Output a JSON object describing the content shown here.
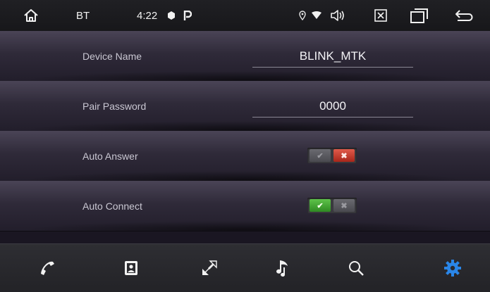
{
  "status_bar": {
    "app_label": "BT",
    "time": "4:22",
    "icons": [
      "home-icon",
      "record-icon",
      "parking-icon",
      "location-pin-icon",
      "wifi-icon",
      "volume-icon",
      "close-box-icon",
      "recent-apps-icon",
      "back-icon"
    ]
  },
  "settings": [
    {
      "label": "Device Name",
      "value": "BLINK_MTK"
    },
    {
      "label": "Pair Password",
      "value": "0000"
    },
    {
      "label": "Auto Answer",
      "toggle": "off"
    },
    {
      "label": "Auto Connect",
      "toggle": "on"
    }
  ],
  "toggle_glyphs": {
    "on": "✔",
    "off": "✖"
  },
  "bottom_nav": {
    "items": [
      "phone-icon",
      "contacts-icon",
      "transfer-icon",
      "music-icon",
      "search-icon",
      "settings-gear-icon"
    ],
    "active": "settings-gear-icon",
    "active_color": "#2a86e8"
  }
}
